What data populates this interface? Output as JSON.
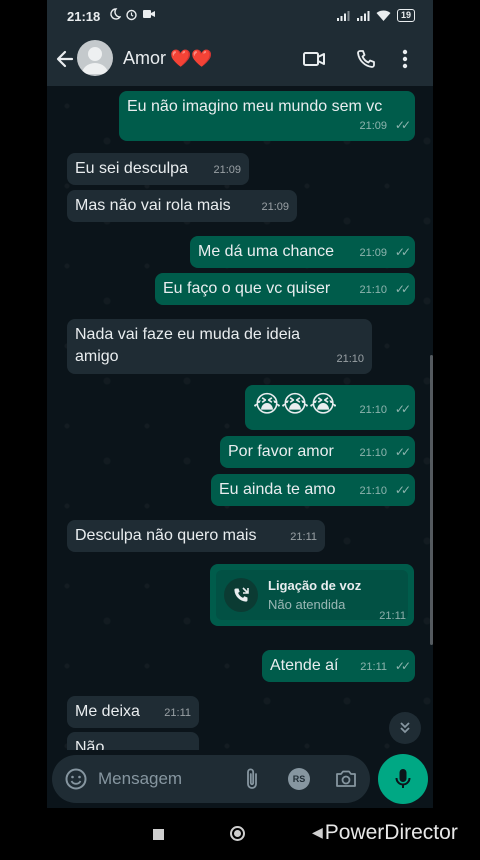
{
  "status_bar": {
    "time": "21:18",
    "battery": "19"
  },
  "header": {
    "contact_name": "Amor",
    "contact_emoji": "❤️❤️"
  },
  "messages": [
    {
      "dir": "out",
      "text": "Eu não imagino meu mundo sem vc",
      "time": "21:09",
      "ticks": "✓✓"
    },
    {
      "dir": "in",
      "text": "Eu sei desculpa",
      "time": "21:09"
    },
    {
      "dir": "in",
      "text": "Mas não vai rola mais",
      "time": "21:09"
    },
    {
      "dir": "out",
      "text": "Me dá uma chance",
      "time": "21:09",
      "ticks": "✓✓"
    },
    {
      "dir": "out",
      "text": "Eu faço o que vc quiser",
      "time": "21:10",
      "ticks": "✓✓"
    },
    {
      "dir": "in",
      "text": "Nada vai faze eu muda de ideia amigo",
      "time": "21:10"
    },
    {
      "dir": "out",
      "text": "😭😭😭",
      "time": "21:10",
      "ticks": "✓✓"
    },
    {
      "dir": "out",
      "text": "Por favor amor",
      "time": "21:10",
      "ticks": "✓✓"
    },
    {
      "dir": "out",
      "text": "Eu ainda te amo",
      "time": "21:10",
      "ticks": "✓✓"
    },
    {
      "dir": "in",
      "text": "Desculpa não quero mais",
      "time": "21:11"
    },
    {
      "dir": "out",
      "text": "Atende aí",
      "time": "21:11",
      "ticks": "✓✓"
    },
    {
      "dir": "in",
      "text": "Me deixa",
      "time": "21:11"
    },
    {
      "dir": "in",
      "text": "Não",
      "time": ""
    }
  ],
  "call_card": {
    "title": "Ligação de voz",
    "subtitle": "Não atendida",
    "time": "21:11"
  },
  "composer": {
    "placeholder": "Mensagem",
    "rs_label": "RS"
  },
  "watermark": {
    "text": "PowerDirector"
  }
}
